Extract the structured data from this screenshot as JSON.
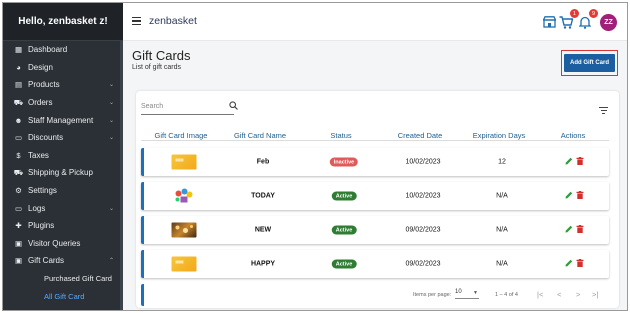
{
  "sidebar": {
    "greeting": "Hello, zenbasket z!",
    "items": [
      {
        "label": "Dashboard",
        "icon": "▦",
        "chevron": false
      },
      {
        "label": "Design",
        "icon": "◕",
        "chevron": false
      },
      {
        "label": "Products",
        "icon": "▤",
        "chevron": true
      },
      {
        "label": "Orders",
        "icon": "⛟",
        "chevron": true
      },
      {
        "label": "Staff Management",
        "icon": "☻",
        "chevron": true
      },
      {
        "label": "Discounts",
        "icon": "▭",
        "chevron": true
      },
      {
        "label": "Taxes",
        "icon": "$",
        "chevron": false
      },
      {
        "label": "Shipping & Pickup",
        "icon": "⛟",
        "chevron": false
      },
      {
        "label": "Settings",
        "icon": "⚙",
        "chevron": false
      },
      {
        "label": "Logs",
        "icon": "▭",
        "chevron": true
      },
      {
        "label": "Plugins",
        "icon": "✚",
        "chevron": false
      },
      {
        "label": "Visitor Queries",
        "icon": "▣",
        "chevron": false
      },
      {
        "label": "Gift Cards",
        "icon": "▣",
        "chevron": true
      }
    ],
    "chevron_down": "⌄",
    "chevron_up": "⌃",
    "sub_items": [
      "Purchased Gift Card",
      "All Gift Card"
    ]
  },
  "topbar": {
    "brand": "zenbasket",
    "cart_badge": "1",
    "notif_badge": "9",
    "avatar_initials": "ZZ",
    "store_icon": "store-icon",
    "cart_icon": "cart-icon",
    "bell_icon": "bell-icon"
  },
  "page": {
    "title": "Gift Cards",
    "subtitle": "List of gift cards",
    "add_button": "Add Gift Card"
  },
  "table": {
    "search_placeholder": "Search",
    "columns": [
      "Gift Card Image",
      "Gift Card Name",
      "Status",
      "Created Date",
      "Expiration Days",
      "Actions"
    ],
    "rows": [
      {
        "name": "Feb",
        "status": "Inactive",
        "created": "10/02/2023",
        "expiration": "12",
        "image": "yellow"
      },
      {
        "name": "TODAY",
        "status": "Active",
        "created": "10/02/2023",
        "expiration": "N/A",
        "image": "today"
      },
      {
        "name": "NEW",
        "status": "Active",
        "created": "09/02/2023",
        "expiration": "N/A",
        "image": "new"
      },
      {
        "name": "HAPPY",
        "status": "Active",
        "created": "09/02/2023",
        "expiration": "N/A",
        "image": "yellow"
      }
    ]
  },
  "pagination": {
    "items_per_page_label": "Items per page:",
    "items_per_page": "10",
    "range": "1 – 4 of 4",
    "first": "|<",
    "prev": "<",
    "next": ">",
    "last": ">|"
  },
  "colors": {
    "sidebar_bg": "#2b3036",
    "accent": "#1c5fa0",
    "active_status": "#2e7d32",
    "inactive_status": "#e05a5a",
    "avatar": "#a01f78"
  }
}
